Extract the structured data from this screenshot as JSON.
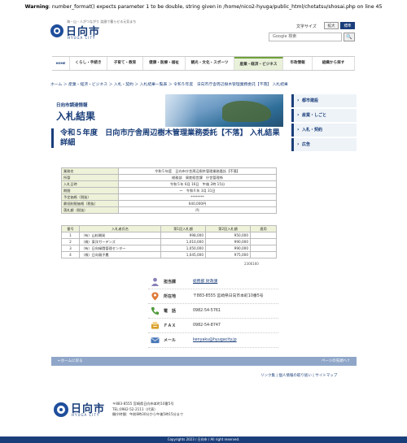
{
  "warning": {
    "prefix": "Warning",
    "message": ": number_format() expects parameter 1 to be double, string given in /home/nico2-hyuga/public_html/chotatsu/shosai.php on line 45"
  },
  "header": {
    "tagline": "海・山・人がつながり 笑顔で暮らせる元気まち",
    "logo_text": "日向市",
    "logo_sub": "HYUGA CITY",
    "font_size_label": "文字サイズ",
    "font_large": "拡大",
    "font_standard": "標準",
    "search_placeholder": "Google 検索",
    "search_button": "🔍"
  },
  "nav": {
    "home": "HOME",
    "items": [
      "くらし・手続き",
      "子育て・教育",
      "健康・医療・福祉",
      "観光・文化・スポーツ",
      "産業・経済・ビジネス",
      "市政情報",
      "組織から探す"
    ]
  },
  "breadcrumb": "ホーム ＞ 産業・経済・ビジネス ＞ 入札・契約 ＞ 入札結果一覧表 ＞ 令和５年度　日向市庁舎周辺樹木管理業務委託【不落】 入札結果",
  "banner": {
    "dept": "日向市調達情報",
    "title": "入札結果"
  },
  "sidebar": [
    "都市建設",
    "産業・しごと",
    "入札・契約",
    "広告"
  ],
  "page_title": "令和５年度　日向市庁舎周辺樹木管理業務委託【不落】 入札結果 詳細",
  "info": [
    {
      "k": "業務名",
      "v": "令和５年度　日向市庁舎周辺樹木管理業務委託【不落】"
    },
    {
      "k": "所管",
      "v": "総務部　資産経営課　庁舎管理係"
    },
    {
      "k": "入札日時",
      "v": "令和５年 6月 16日　午後 2時 15分"
    },
    {
      "k": "期間",
      "v": "～　令和６年 3月 31日"
    },
    {
      "k": "予定価格（税抜）",
      "v": "********"
    },
    {
      "k": "最低制限価格（税抜）",
      "v": "640,000円"
    },
    {
      "k": "落札額（税抜）",
      "v": "円"
    }
  ],
  "bids": {
    "headers": [
      "番号",
      "入札者氏名",
      "第1回入札額",
      "第2回入札額",
      "適用"
    ],
    "rows": [
      [
        "1",
        "（有）山松開発",
        "998,000",
        "950,000",
        ""
      ],
      [
        "2",
        "（株）東洋ガーデンズ",
        "1,010,000",
        "990,000",
        ""
      ],
      [
        "3",
        "（有）日向緑園管理センター",
        "1,050,000",
        "990,000",
        ""
      ],
      [
        "4",
        "（株）日向親子農",
        "1,045,000",
        "975,000",
        ""
      ]
    ]
  },
  "doc_no": "2306160",
  "contact": [
    {
      "icon": "person-icon",
      "label": "担当課",
      "value": "総務部 財政課",
      "link": true
    },
    {
      "icon": "location-icon",
      "label": "所在地",
      "value": "〒883-8555 宮崎県日向市本町10番5号",
      "link": false
    },
    {
      "icon": "phone-icon",
      "label": "電　話",
      "value": "0982-54-5761",
      "link": false
    },
    {
      "icon": "fax-icon",
      "label": "ＦＡＸ",
      "value": "0982-54-8747",
      "link": false
    },
    {
      "icon": "mail-icon",
      "label": "メール",
      "value": "kenyaku@hyugacity.jp",
      "link": true
    }
  ],
  "footer_bar": {
    "left": "←ホームに戻る",
    "right": "ページの先頭へ↑"
  },
  "footer_links": "リンク集 | 個人情報の取り扱い | サイトマップ",
  "footer": {
    "logo_text": "日向市",
    "logo_sub": "HYUGA CITY",
    "address": "〒883-8555 宮崎県日向市本町10番5号",
    "tel": "TEL:0982-52-2111（代表）",
    "hours": "開庁時間：午前8時30分から午後5時15分まで"
  },
  "copyright": "Copyrights 2023 / 日向市 / All right reserved.",
  "colors": {
    "brand": "#1a3e7a",
    "accent": "#6fa23a",
    "table_header": "#eef2d9"
  }
}
